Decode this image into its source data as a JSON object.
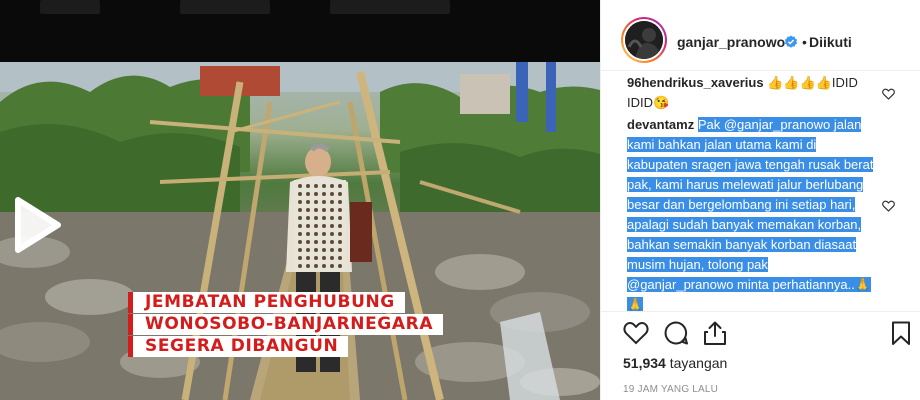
{
  "video": {
    "caption_lines": [
      "JEMBATAN PENGHUBUNG",
      "WONOSOBO-BANJARNEGARA",
      "SEGERA DIBANGUN"
    ]
  },
  "header": {
    "username": "ganjar_pranowo",
    "separator": "•",
    "follow_status": "Diikuti"
  },
  "comments": [
    {
      "user": "96hendrikus_xaverius",
      "text": " 👍👍👍👍IDID IDID😘"
    },
    {
      "user": "devantamz",
      "text": "Pak @ganjar_pranowo jalan kami bahkan jalan utama kami di kabupaten sragen jawa tengah rusak berat pak, kami harus melewati jalur berlubang besar dan bergelombang ini setiap hari, apalagi sudah banyak memakan korban, bahkan semakin banyak korban diasaat musim hujan, tolong pak @ganjar_pranowo minta perhatiannya..🙏🙏"
    }
  ],
  "stats": {
    "views_count": "51,934",
    "views_label": "tayangan",
    "timestamp": "19 JAM YANG LALU"
  },
  "icons": {
    "like": "heart-icon",
    "comment": "comment-icon",
    "share": "share-icon",
    "save": "bookmark-icon",
    "play": "play-icon",
    "verified": "verified-badge-icon"
  },
  "colors": {
    "selection": "#3a8ee6",
    "verified": "#3897f0",
    "caption_red": "#d31c1c"
  }
}
